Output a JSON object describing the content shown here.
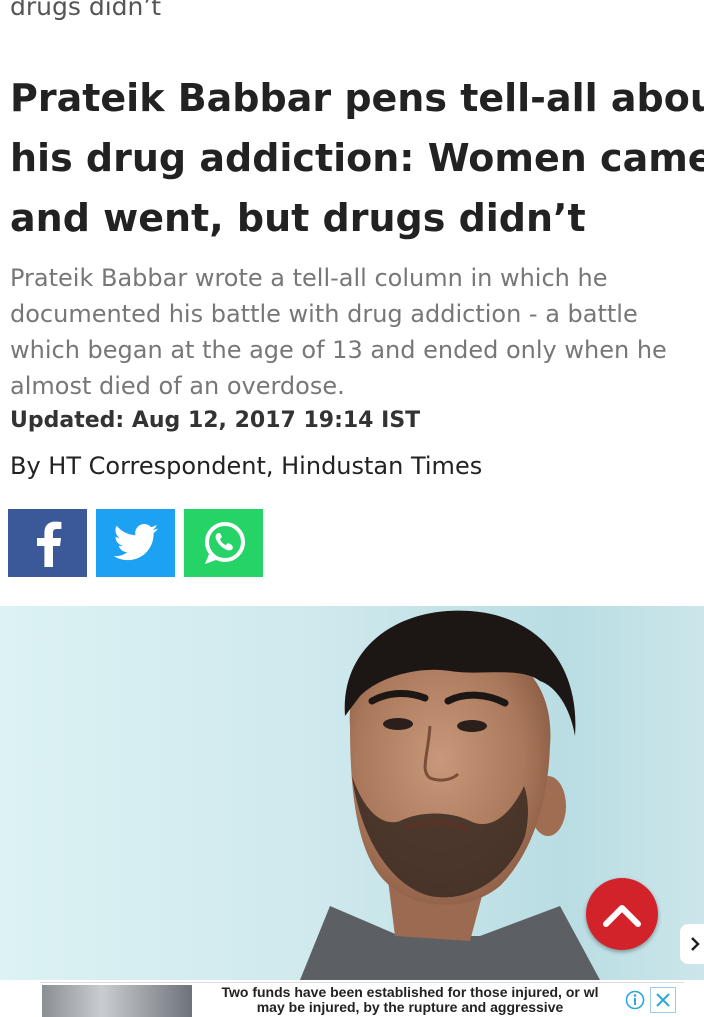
{
  "top_crumb": "drugs didn’t",
  "headline": {
    "lines": [
      "Prateik Babbar pens tell-all about",
      "his drug addiction: Women came",
      "and went, but drugs didn’t"
    ]
  },
  "summary": {
    "lines": [
      "Prateik Babbar wrote a tell-all column in which he",
      "documented his battle with drug addiction - a battle",
      "which began at the age of 13 and ended only when he",
      "almost died of an overdose."
    ]
  },
  "updated": "Updated: Aug 12, 2017 19:14 IST",
  "byline": "By HT Correspondent, Hindustan Times",
  "share": {
    "buttons": [
      {
        "name": "facebook",
        "icon": "facebook-icon",
        "color": "#3b5998"
      },
      {
        "name": "twitter",
        "icon": "twitter-icon",
        "color": "#1da1f2"
      },
      {
        "name": "whatsapp",
        "icon": "whatsapp-icon",
        "color": "#25d366"
      }
    ]
  },
  "scroll_top": {
    "icon": "chevron-up-icon",
    "color": "#d2232a"
  },
  "side_tab": {
    "icon": "chevron-right-icon"
  },
  "ad": {
    "lines": [
      "Two funds have been established for those injured, or wl",
      "may be injured, by the rupture and aggressive"
    ],
    "info_icon": "info-icon",
    "close_icon": "close-icon"
  }
}
